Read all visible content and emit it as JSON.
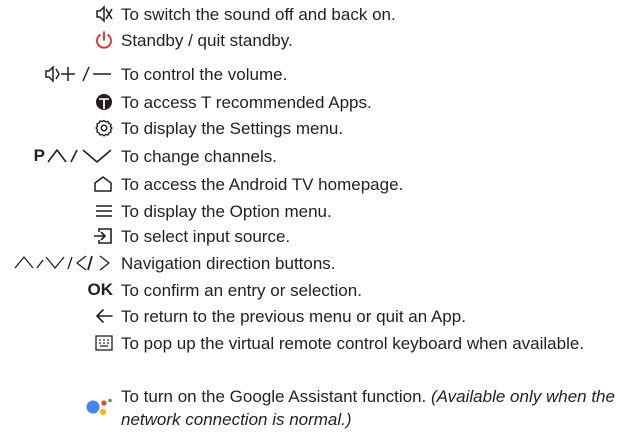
{
  "items": [
    {
      "icon": "mute-icon",
      "text": "To switch the sound off and back on."
    },
    {
      "icon": "power-icon",
      "text": "Standby / quit standby.",
      "color": "#e8262b"
    },
    {
      "icon": "volume-icon",
      "text": "To control the volume."
    },
    {
      "icon": "t-apps-icon",
      "text": "To access T recommended Apps."
    },
    {
      "icon": "settings-gear-icon",
      "text": "To display the Settings menu."
    },
    {
      "icon": "channel-icon",
      "icon_text": "P",
      "text": "To change channels."
    },
    {
      "icon": "home-icon",
      "text": "To access the Android TV homepage."
    },
    {
      "icon": "menu-icon",
      "text": "To display the Option menu."
    },
    {
      "icon": "input-source-icon",
      "text": "To select input source."
    },
    {
      "icon": "navigation-arrows-icon",
      "text": "Navigation direction buttons."
    },
    {
      "icon": "ok-icon",
      "icon_text": "OK",
      "text": "To confirm an entry or selection."
    },
    {
      "icon": "back-arrow-icon",
      "text": "To return to the previous menu or quit an App."
    },
    {
      "icon": "keyboard-icon",
      "text": "To pop up the virtual remote control keyboard when available."
    },
    {
      "icon": "google-assistant-icon",
      "text": "To turn on the Google Assistant function.",
      "note": "(Available only when the network connection is normal.)",
      "colors": [
        "#4285f4",
        "#ea4335",
        "#fbbc05",
        "#34a853"
      ]
    }
  ]
}
